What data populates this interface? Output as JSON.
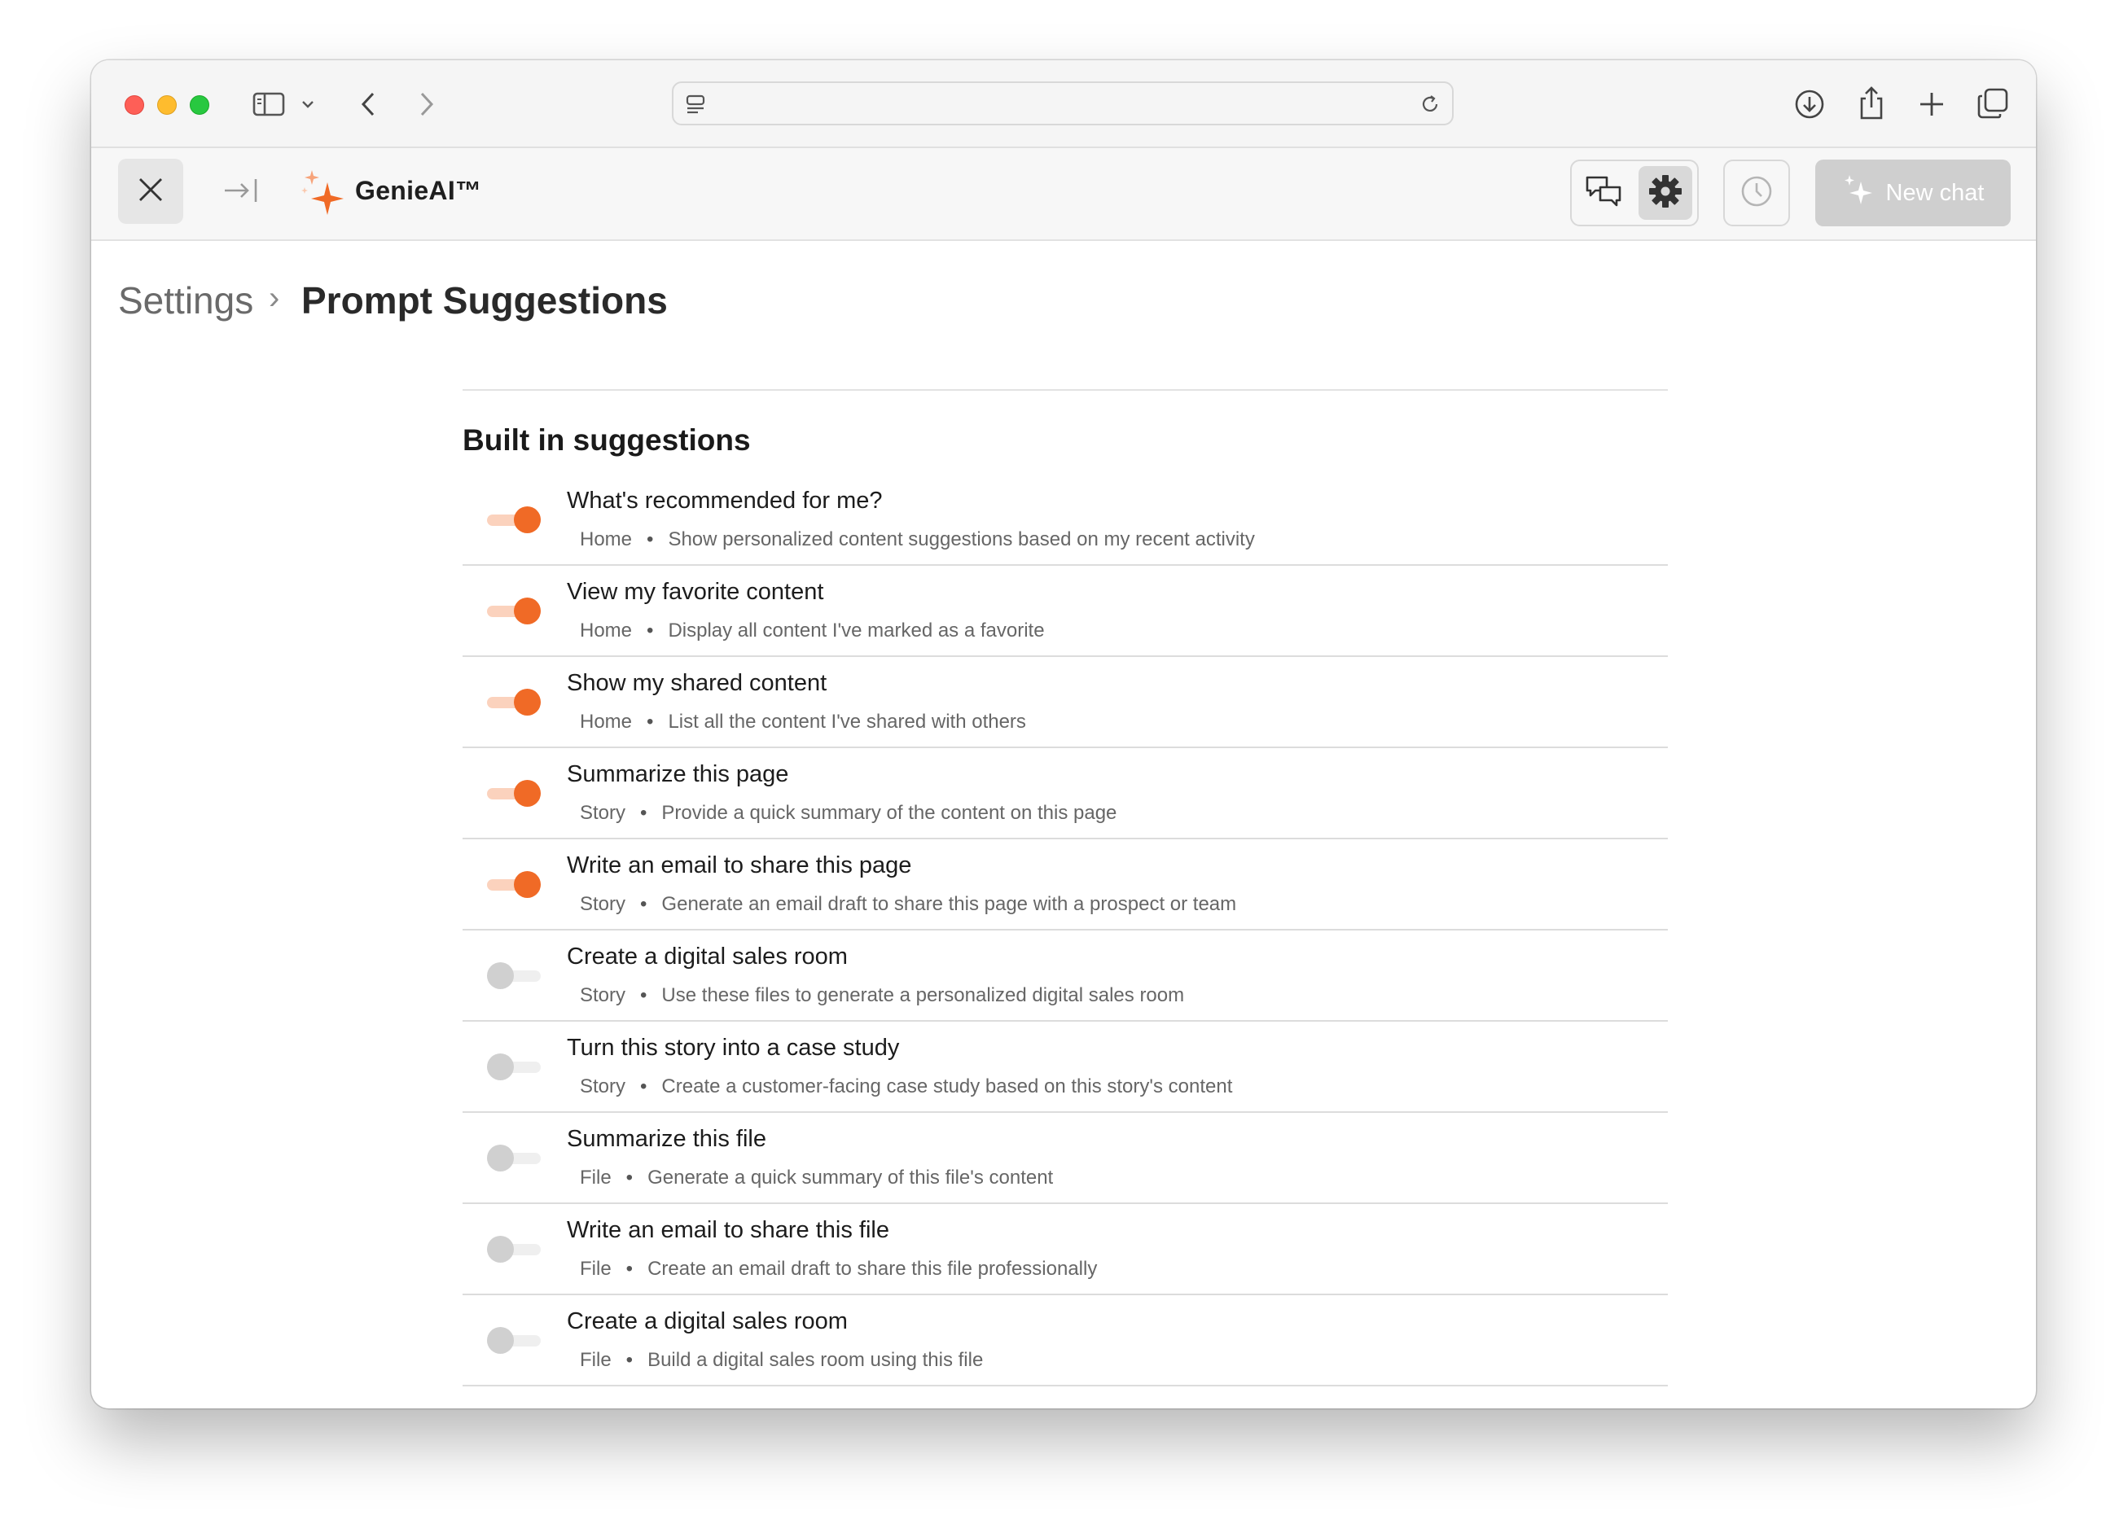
{
  "brand": {
    "name": "GenieAI™"
  },
  "appbar": {
    "new_chat_label": "New chat"
  },
  "breadcrumb": {
    "root": "Settings",
    "separator": "›",
    "current": "Prompt Suggestions"
  },
  "section": {
    "title": "Built in suggestions"
  },
  "suggestions": [
    {
      "title": "What's recommended for me?",
      "category": "Home",
      "description": "Show personalized content suggestions based on my recent activity",
      "enabled": true
    },
    {
      "title": "View my favorite content",
      "category": "Home",
      "description": "Display all content I've marked as a favorite",
      "enabled": true
    },
    {
      "title": "Show my shared content",
      "category": "Home",
      "description": "List all the content I've shared with others",
      "enabled": true
    },
    {
      "title": "Summarize this page",
      "category": "Story",
      "description": "Provide a quick summary of the content on this page",
      "enabled": true
    },
    {
      "title": "Write an email to share this page",
      "category": "Story",
      "description": "Generate an email draft to share this page with a prospect or team",
      "enabled": true
    },
    {
      "title": "Create a digital sales room",
      "category": "Story",
      "description": "Use these files to generate a personalized digital sales room",
      "enabled": false
    },
    {
      "title": "Turn this story into a case study",
      "category": "Story",
      "description": "Create a customer-facing case study based on this story's content",
      "enabled": false
    },
    {
      "title": "Summarize this file",
      "category": "File",
      "description": "Generate a quick summary of this file's content",
      "enabled": false
    },
    {
      "title": "Write an email to share this file",
      "category": "File",
      "description": "Create an email draft to share this file professionally",
      "enabled": false
    },
    {
      "title": "Create a digital sales room",
      "category": "File",
      "description": "Build a digital sales room using this file",
      "enabled": false
    }
  ],
  "colors": {
    "accent": "#f06a26",
    "accent_track": "#fbd2bd",
    "off_knob": "#d0d0d0"
  }
}
